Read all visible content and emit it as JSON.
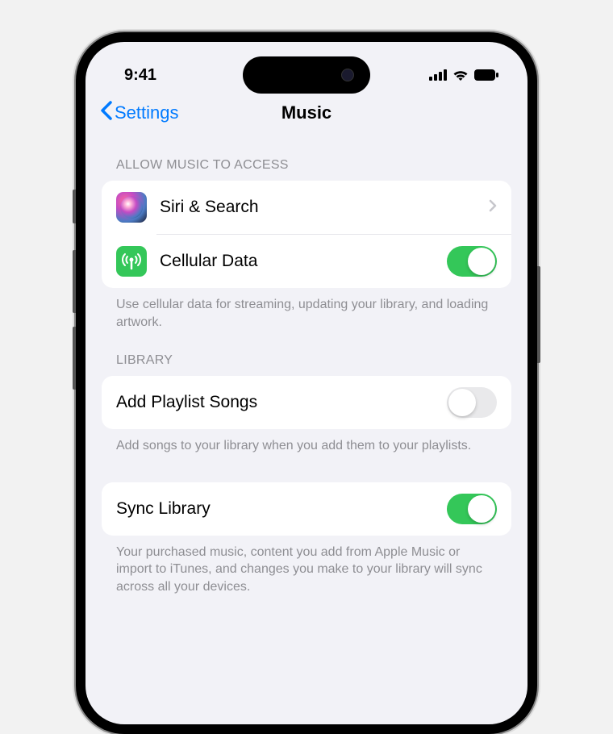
{
  "status_bar": {
    "time": "9:41"
  },
  "nav": {
    "back_label": "Settings",
    "title": "Music"
  },
  "sections": {
    "access": {
      "header": "ALLOW MUSIC TO ACCESS",
      "siri_label": "Siri & Search",
      "cellular_label": "Cellular Data",
      "cellular_on": true,
      "footer": "Use cellular data for streaming, updating your library, and loading artwork."
    },
    "library": {
      "header": "LIBRARY",
      "add_playlist_label": "Add Playlist Songs",
      "add_playlist_on": false,
      "add_playlist_footer": "Add songs to your library when you add them to your playlists.",
      "sync_label": "Sync Library",
      "sync_on": true,
      "sync_footer": "Your purchased music, content you add from Apple Music or import to iTunes, and changes you make to your library will sync across all your devices."
    }
  }
}
